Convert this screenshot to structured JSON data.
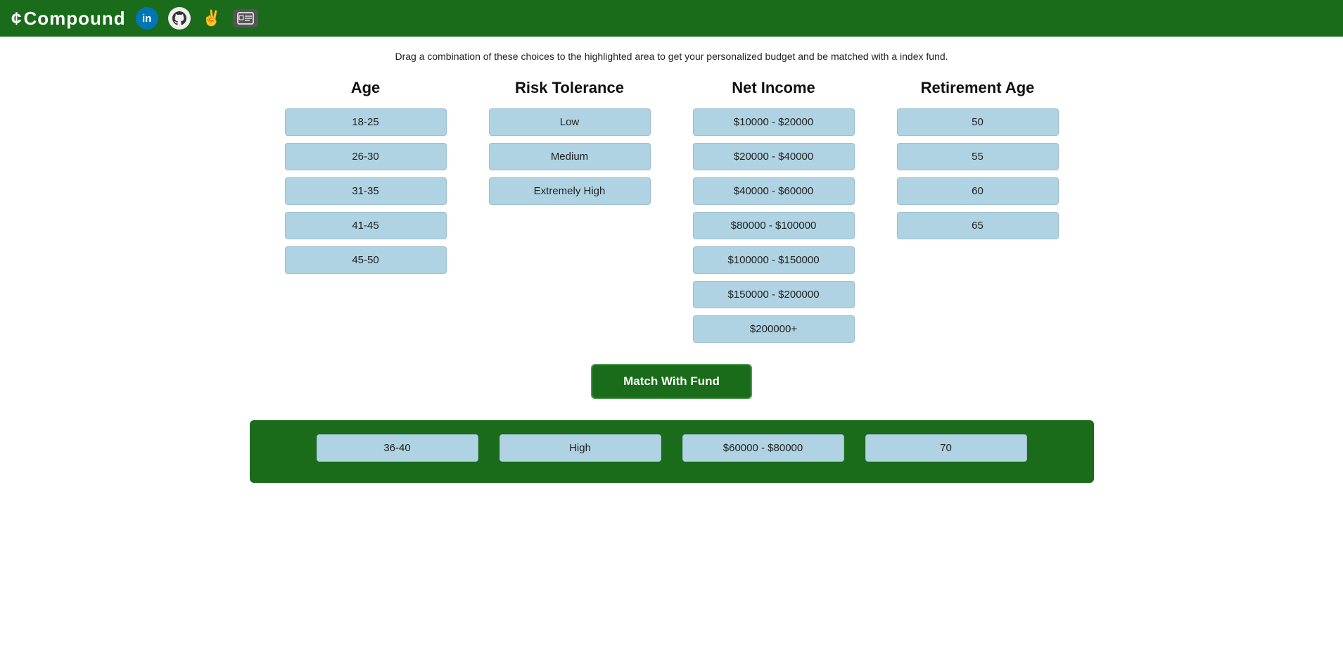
{
  "navbar": {
    "logo": "Compound",
    "icons": [
      {
        "name": "linkedin-icon",
        "symbol": "in",
        "type": "linkedin"
      },
      {
        "name": "github-icon",
        "symbol": "⊙",
        "type": "github"
      },
      {
        "name": "peace-icon",
        "symbol": "✌",
        "type": "peace"
      },
      {
        "name": "id-card-icon",
        "symbol": "⊡",
        "type": "id"
      }
    ]
  },
  "instruction": "Drag a combination of these choices to the highlighted area to get your personalized budget and be matched with a index fund.",
  "columns": [
    {
      "id": "age",
      "header": "Age",
      "options": [
        "18-25",
        "26-30",
        "31-35",
        "41-45",
        "45-50"
      ]
    },
    {
      "id": "risk_tolerance",
      "header": "Risk Tolerance",
      "options": [
        "Low",
        "Medium",
        "Extremely High"
      ]
    },
    {
      "id": "net_income",
      "header": "Net Income",
      "options": [
        "$10000 - $20000",
        "$20000 - $40000",
        "$40000 - $60000",
        "$80000 - $100000",
        "$100000 - $150000",
        "$150000 - $200000",
        "$200000+"
      ]
    },
    {
      "id": "retirement_age",
      "header": "Retirement Age",
      "options": [
        "50",
        "55",
        "60",
        "65"
      ]
    }
  ],
  "match_button_label": "Match With Fund",
  "dropped_cards": [
    {
      "column": "age",
      "value": "36-40"
    },
    {
      "column": "risk_tolerance",
      "value": "High"
    },
    {
      "column": "net_income",
      "value": "$60000 - $80000"
    },
    {
      "column": "retirement_age",
      "value": "70"
    }
  ]
}
